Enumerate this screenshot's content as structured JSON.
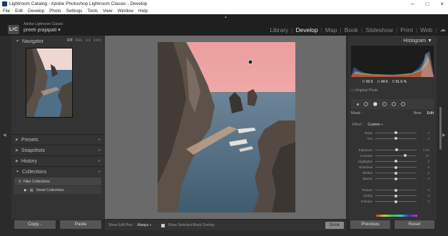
{
  "window": {
    "title": "Lightroom Catalog - Adobe Photoshop Lightroom Classic - Develop",
    "controls": [
      "–",
      "□",
      "×"
    ]
  },
  "menu": [
    "File",
    "Edit",
    "Develop",
    "Photo",
    "Settings",
    "Tools",
    "View",
    "Window",
    "Help"
  ],
  "identity": {
    "badge": "LrC",
    "app_name": "Adobe Lightroom Classic",
    "user": "preeti prajapati ▾"
  },
  "modules": [
    {
      "label": "Library",
      "active": false
    },
    {
      "label": "Develop",
      "active": true
    },
    {
      "label": "Map",
      "active": false
    },
    {
      "label": "Book",
      "active": false
    },
    {
      "label": "Slideshow",
      "active": false
    },
    {
      "label": "Print",
      "active": false
    },
    {
      "label": "Web",
      "active": false
    }
  ],
  "left_panel": {
    "navigator": {
      "title": "Navigator",
      "zoom_options": [
        "FIT",
        "FILL",
        "1:1",
        "1:4 ‡"
      ]
    },
    "presets": "Presets",
    "snapshots": "Snapshots",
    "history": "History",
    "collections": "Collections",
    "collection_items": [
      "Filter Collections",
      "Smart Collections"
    ],
    "copy_button": "Copy...",
    "paste_button": "Paste"
  },
  "toolbar": {
    "show_edit_pins_label": "Show Edit Pins :",
    "show_edit_pins_value": "Always ÷",
    "overlay_label": "Show Selected Mask Overlay",
    "done_button": "Done"
  },
  "right_panel": {
    "histogram_title": "Histogram ▼",
    "rgb": {
      "R": "92.6",
      "G": "94.6",
      "B": "91.6 %"
    },
    "original_photo": "Original Photo",
    "mask_label": "Mask :",
    "new_label": "New",
    "edit_label": "Edit",
    "effect_label": "Effect :",
    "effect_value": "Custom ÷",
    "sliders": [
      {
        "label": "Temp",
        "value": "0",
        "pos": 50
      },
      {
        "label": "Tint",
        "value": "0",
        "pos": 50
      },
      {
        "label": "Exposure",
        "value": "0.03",
        "pos": 51,
        "gap": true
      },
      {
        "label": "Contrast",
        "value": "47",
        "pos": 73
      },
      {
        "label": "Highlights",
        "value": "0",
        "pos": 50
      },
      {
        "label": "Shadows",
        "value": "0",
        "pos": 50
      },
      {
        "label": "Whites",
        "value": "0",
        "pos": 50
      },
      {
        "label": "Blacks",
        "value": "0",
        "pos": 50
      },
      {
        "label": "Texture",
        "value": "0",
        "pos": 50,
        "gap": true
      },
      {
        "label": "Clarity",
        "value": "0",
        "pos": 50
      },
      {
        "label": "Dehaze",
        "value": "0",
        "pos": 50
      }
    ],
    "hue_label": "Hue",
    "hue_value": "0.0",
    "previous_button": "Previous",
    "reset_button": "Reset"
  },
  "colors": {
    "panel": "#333333",
    "background": "#2b2b2b",
    "sky": "#e9a4a3",
    "sea": "#4f6f86"
  }
}
